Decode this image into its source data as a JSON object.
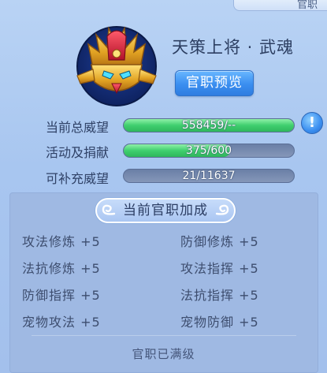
{
  "top_tab": {
    "label": "官职"
  },
  "rank": {
    "title": "天策上将 · 武魂",
    "preview_label": "官职预览"
  },
  "stats": [
    {
      "label": "当前总威望",
      "value_text": "558459/--",
      "fill": 1.0
    },
    {
      "label": "活动及捐献",
      "value_text": "375/600",
      "fill": 0.625
    },
    {
      "label": "可补充威望",
      "value_text": "21/11637",
      "fill": 0.0
    }
  ],
  "help": {
    "label": "!"
  },
  "bonus_panel": {
    "title": "当前官职加成",
    "items": [
      {
        "text": "攻法修炼 +5"
      },
      {
        "text": "防御修炼 +5"
      },
      {
        "text": "法抗修炼 +5"
      },
      {
        "text": "攻法指挥 +5"
      },
      {
        "text": "防御指挥 +5"
      },
      {
        "text": "法抗指挥 +5"
      },
      {
        "text": "宠物攻法 +5"
      },
      {
        "text": "宠物防御 +5"
      }
    ],
    "footer": "官职已满级"
  },
  "colors": {
    "accent": "#3a8ef0",
    "bar_fill": "#3fcf6e",
    "bar_track": "#7689ad"
  }
}
